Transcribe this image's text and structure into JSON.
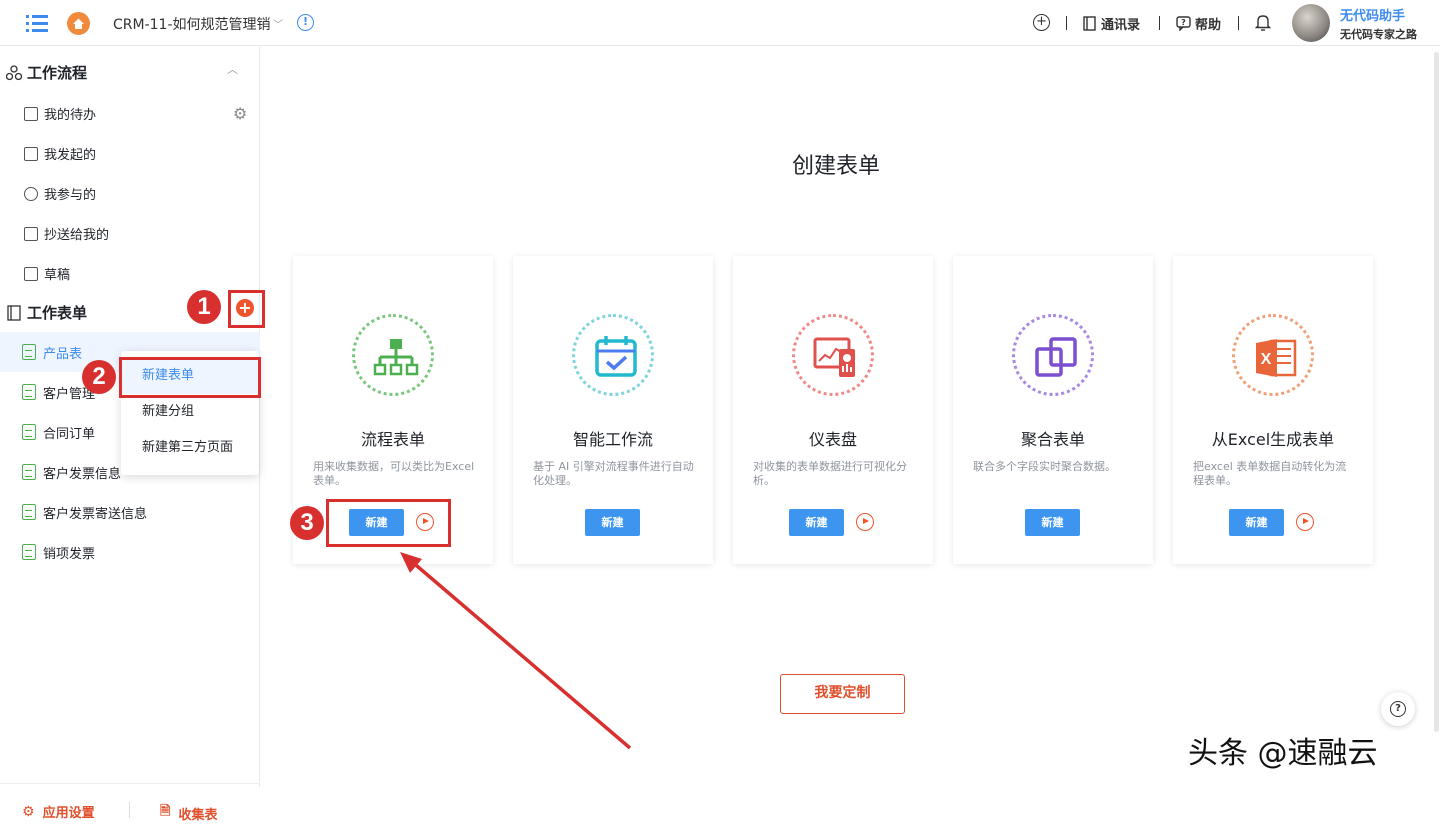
{
  "header": {
    "app_title": "CRM-11-如何规范管理销",
    "contacts_label": "通讯录",
    "help_label": "帮助",
    "user_name": "无代码助手",
    "user_sub": "无代码专家之路"
  },
  "sidebar": {
    "workflow_title": "工作流程",
    "workflow_items": [
      {
        "label": "我的待办",
        "icon": "todo-icon"
      },
      {
        "label": "我发起的",
        "icon": "initiated-icon"
      },
      {
        "label": "我参与的",
        "icon": "participant-icon"
      },
      {
        "label": "抄送给我的",
        "icon": "cc-icon"
      },
      {
        "label": "草稿",
        "icon": "draft-icon"
      }
    ],
    "forms_title": "工作表单",
    "form_items": [
      {
        "label": "产品表",
        "active": true
      },
      {
        "label": "客户管理"
      },
      {
        "label": "合同订单"
      },
      {
        "label": "客户发票信息"
      },
      {
        "label": "客户发票寄送信息"
      },
      {
        "label": "销项发票"
      }
    ],
    "footer": {
      "settings_label": "应用设置",
      "collect_label": "收集表"
    }
  },
  "dropdown": {
    "items": [
      "新建表单",
      "新建分组",
      "新建第三方页面"
    ]
  },
  "main": {
    "title": "创建表单",
    "cards": [
      {
        "title": "流程表单",
        "desc": "用来收集数据，可以类比为Excel 表单。",
        "button": "新建",
        "has_video": true,
        "icon": "flow-chart-icon",
        "color": "#4caf50"
      },
      {
        "title": "智能工作流",
        "desc": "基于 AI 引擎对流程事件进行自动化处理。",
        "button": "新建",
        "has_video": false,
        "icon": "calendar-check-icon",
        "color": "#22b8cf"
      },
      {
        "title": "仪表盘",
        "desc": "对收集的表单数据进行可视化分析。",
        "button": "新建",
        "has_video": true,
        "icon": "dashboard-icon",
        "color": "#e0504d"
      },
      {
        "title": "聚合表单",
        "desc": "联合多个字段实时聚合数据。",
        "button": "新建",
        "has_video": false,
        "icon": "aggregate-icon",
        "color": "#7b4fd0"
      },
      {
        "title": "从Excel生成表单",
        "desc": "把excel 表单数据自动转化为流程表单。",
        "button": "新建",
        "has_video": true,
        "icon": "excel-icon",
        "color": "#e8663a"
      }
    ],
    "custom_button": "我要定制"
  },
  "annotations": [
    "1",
    "2",
    "3"
  ],
  "watermark": "头条 @速融云"
}
